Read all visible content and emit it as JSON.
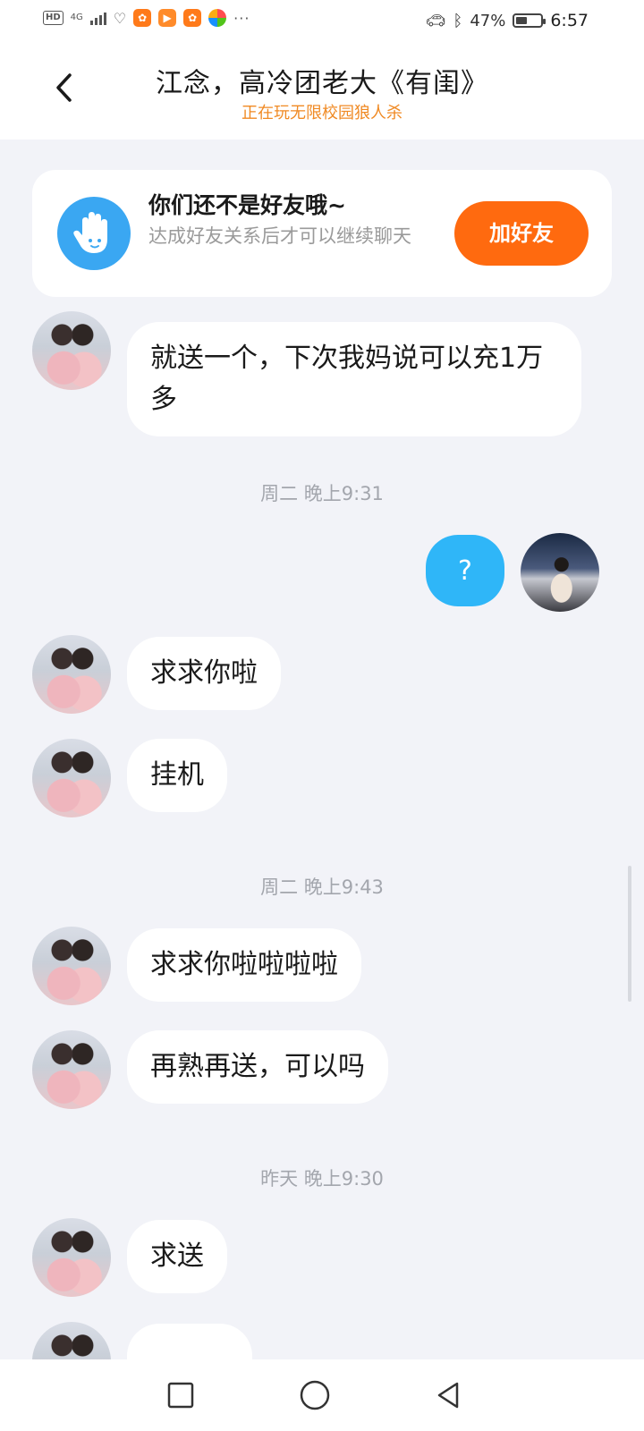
{
  "status_bar": {
    "hd": "HD",
    "network": "4G",
    "battery_percent": "47%",
    "battery_level": 0.47,
    "time": "6:57"
  },
  "header": {
    "title": "江念，高冷团老大《有闺》",
    "subtitle": "正在玩无限校园狼人杀"
  },
  "banner": {
    "title": "你们还不是好友哦~",
    "description": "达成好友关系后才可以继续聊天",
    "button_label": "加好友"
  },
  "messages": [
    {
      "type": "text",
      "from": "them",
      "text": "就送一个，下次我妈说可以充1万多"
    },
    {
      "type": "time",
      "text": "周二 晚上9:31"
    },
    {
      "type": "text",
      "from": "me",
      "text": "?"
    },
    {
      "type": "text",
      "from": "them",
      "text": "求求你啦"
    },
    {
      "type": "text",
      "from": "them",
      "text": "挂机"
    },
    {
      "type": "time",
      "text": "周二 晚上9:43"
    },
    {
      "type": "text",
      "from": "them",
      "text": "求求你啦啦啦啦"
    },
    {
      "type": "text",
      "from": "them",
      "text": "再熟再送，可以吗"
    },
    {
      "type": "time",
      "text": "昨天 晚上9:30"
    },
    {
      "type": "text",
      "from": "them",
      "text": "求送"
    }
  ],
  "icons": {
    "back": "chevron-left-icon",
    "banner": "waving-hand-icon",
    "nav_recent": "square-icon",
    "nav_home": "circle-icon",
    "nav_back": "triangle-back-icon"
  },
  "colors": {
    "accent_orange": "#ff6a0f",
    "subtitle_orange": "#f08a24",
    "my_bubble": "#2fb6f8",
    "background": "#f2f3f8"
  }
}
